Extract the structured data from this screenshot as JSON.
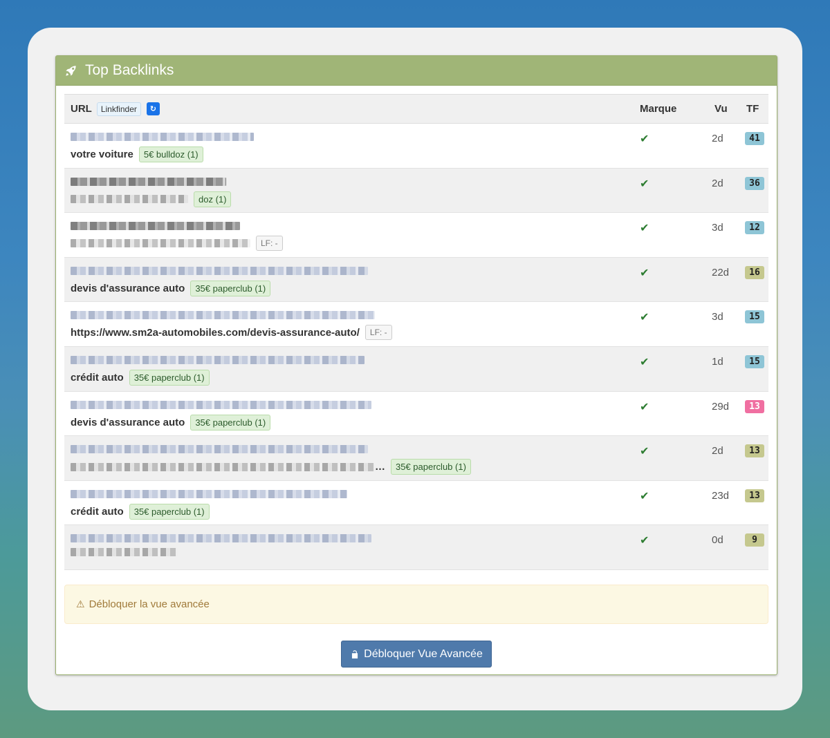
{
  "panel": {
    "title": "Top Backlinks",
    "icon": "rocket-icon"
  },
  "table": {
    "headers": {
      "url": "URL",
      "linkfinder": "Linkfinder",
      "refresh": "↻",
      "marque": "Marque",
      "vu": "Vu",
      "tf": "TF"
    },
    "rows": [
      {
        "anchor": "votre voiture",
        "tag": "5€ bulldoz (1)",
        "tag_type": "green",
        "vu": "2d",
        "tf": "41",
        "tf_color": "blue",
        "line1": "blue-dark",
        "line2": "text"
      },
      {
        "anchor": "",
        "tag": "doz (1)",
        "tag_type": "green",
        "vu": "2d",
        "tf": "36",
        "tf_color": "blue",
        "line1": "dark",
        "line2": "blurred"
      },
      {
        "anchor": "",
        "tag": "LF: -",
        "tag_type": "lf",
        "vu": "3d",
        "tf": "12",
        "tf_color": "blue",
        "line1": "dark",
        "line2": "blurred"
      },
      {
        "anchor": "devis d'assurance auto",
        "tag": "35€ paperclub (1)",
        "tag_type": "green",
        "vu": "22d",
        "tf": "16",
        "tf_color": "olive",
        "line1": "blue",
        "line2": "text"
      },
      {
        "anchor": "https://www.sm2a-automobiles.com/devis-assurance-auto/",
        "tag": "LF: -",
        "tag_type": "lf",
        "vu": "3d",
        "tf": "15",
        "tf_color": "blue",
        "line1": "blue",
        "line2": "text"
      },
      {
        "anchor": "crédit auto",
        "tag": "35€ paperclub (1)",
        "tag_type": "green",
        "vu": "1d",
        "tf": "15",
        "tf_color": "blue",
        "line1": "blue",
        "line2": "text"
      },
      {
        "anchor": "devis d'assurance auto",
        "tag": "35€ paperclub (1)",
        "tag_type": "green",
        "vu": "29d",
        "tf": "13",
        "tf_color": "pink",
        "line1": "blue",
        "line2": "text"
      },
      {
        "anchor": "…",
        "tag": "35€ paperclub (1)",
        "tag_type": "green",
        "vu": "2d",
        "tf": "13",
        "tf_color": "olive",
        "line1": "blue",
        "line2": "blurred"
      },
      {
        "anchor": "crédit auto",
        "tag": "35€ paperclub (1)",
        "tag_type": "green",
        "vu": "23d",
        "tf": "13",
        "tf_color": "olive",
        "line1": "blue",
        "line2": "text"
      },
      {
        "anchor": "",
        "tag": "",
        "tag_type": "none",
        "vu": "0d",
        "tf": "9",
        "tf_color": "olive",
        "line1": "blue",
        "line2": "blurred"
      }
    ]
  },
  "alert": {
    "text": "Débloquer la vue avancée",
    "icon": "warning-icon"
  },
  "unlock_button": {
    "label": "Débloquer Vue Avancée",
    "icon": "unlock-icon"
  },
  "colors": {
    "header": "#a0b577",
    "button": "#4f7aab",
    "alert_bg": "#fcf8e3",
    "check": "#2e7d32"
  }
}
